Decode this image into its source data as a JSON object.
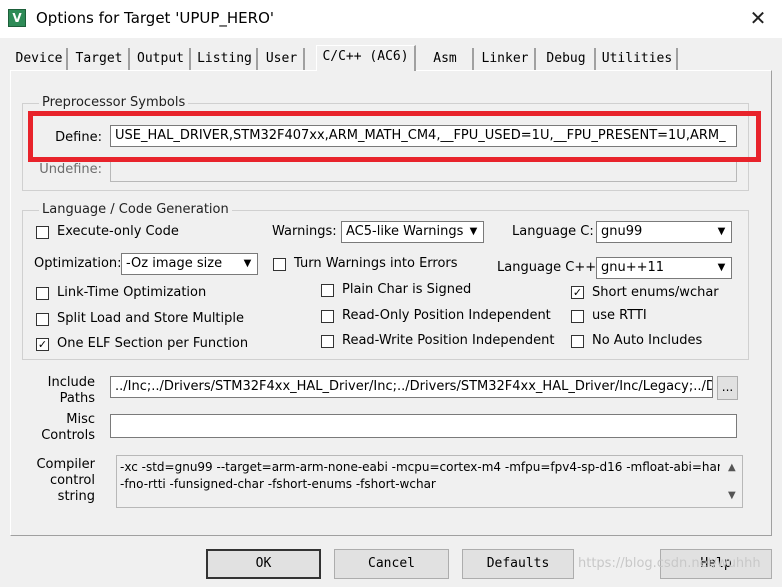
{
  "window": {
    "icon_letter": "V",
    "title": "Options for Target 'UPUP_HERO'",
    "close_glyph": "✕"
  },
  "tabs": [
    "Device",
    "Target",
    "Output",
    "Listing",
    "User",
    "C/C++ (AC6)",
    "Asm",
    "Linker",
    "Debug",
    "Utilities"
  ],
  "active_tab": "C/C++ (AC6)",
  "preprocessor": {
    "group_title": "Preprocessor Symbols",
    "define_label": "Define:",
    "define_value": "USE_HAL_DRIVER,STM32F407xx,ARM_MATH_CM4,__FPU_USED=1U,__FPU_PRESENT=1U,ARM_",
    "undefine_label": "Undefine:",
    "undefine_value": "",
    "highlight_color": "#e8232b"
  },
  "language": {
    "group_title": "Language / Code Generation",
    "execute_only": {
      "label": "Execute-only Code",
      "checked": false
    },
    "warnings": {
      "label": "Warnings:",
      "value": "AC5-like Warnings"
    },
    "language_c": {
      "label": "Language C:",
      "value": "gnu99"
    },
    "optimization": {
      "label": "Optimization:",
      "value": "-Oz image size"
    },
    "turn_warnings": {
      "label": "Turn Warnings into Errors",
      "checked": false
    },
    "language_cpp": {
      "label": "Language C++:",
      "value": "gnu++11"
    },
    "link_time": {
      "label": "Link-Time Optimization",
      "checked": false
    },
    "plain_char": {
      "label": "Plain Char is Signed",
      "checked": false
    },
    "short_enums": {
      "label": "Short enums/wchar",
      "checked": true
    },
    "split_load": {
      "label": "Split Load and Store Multiple",
      "checked": false
    },
    "ro_pi": {
      "label": "Read-Only Position Independent",
      "checked": false
    },
    "use_rtti": {
      "label": "use RTTI",
      "checked": false
    },
    "one_elf": {
      "label": "One ELF Section per Function",
      "checked": true
    },
    "rw_pi": {
      "label": "Read-Write Position Independent",
      "checked": false
    },
    "no_auto_includes": {
      "label": "No Auto Includes",
      "checked": false
    }
  },
  "include_paths": {
    "label_line1": "Include",
    "label_line2": "Paths",
    "value": "../Inc;../Drivers/STM32F4xx_HAL_Driver/Inc;../Drivers/STM32F4xx_HAL_Driver/Inc/Legacy;../Driv",
    "browse_label": "..."
  },
  "misc_controls": {
    "label_line1": "Misc",
    "label_line2": "Controls",
    "value": ""
  },
  "compiler_control": {
    "label_line1": "Compiler",
    "label_line2": "control",
    "label_line3": "string",
    "line1": "-xc -std=gnu99 --target=arm-arm-none-eabi -mcpu=cortex-m4 -mfpu=fpv4-sp-d16 -mfloat-abi=hard -c",
    "line2": "-fno-rtti -funsigned-char -fshort-enums -fshort-wchar"
  },
  "buttons": {
    "ok": "OK",
    "cancel": "Cancel",
    "defaults": "Defaults",
    "help": "Help"
  },
  "watermark": "https://blog.csdn.net/wuhhh"
}
